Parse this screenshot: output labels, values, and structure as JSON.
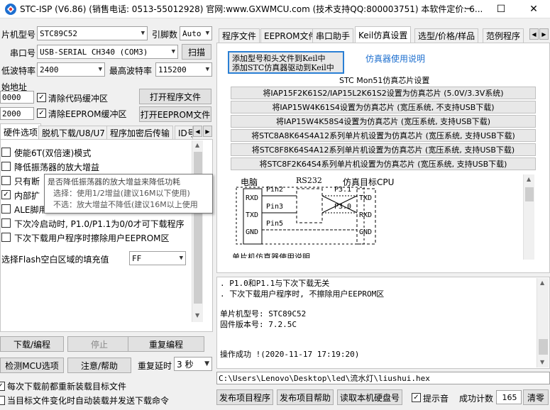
{
  "window": {
    "title": "STC-ISP (V6.86) (销售电话: 0513-55012928) 官网:www.GXWMCU.com  (技术支持QQ:800003751) 本软件定价: 6...",
    "minimize": "─",
    "maximize": "☐",
    "close": "✕"
  },
  "left": {
    "mcu_type_label": "片机型号",
    "mcu_type_value": "STC89C52",
    "pin_label": "引脚数",
    "pin_value": "Auto",
    "port_label": "串口号",
    "port_value": "USB-SERIAL CH340 (COM3)",
    "scan_button": "扫描",
    "min_baud_label": "低波特率",
    "min_baud_value": "2400",
    "max_baud_label": "最高波特率",
    "max_baud_value": "115200",
    "start_addr_label": "始地址",
    "code_addr_value": "0000",
    "clear_code_label": "清除代码缓冲区",
    "open_prog_button": "打开程序文件",
    "eeprom_addr_value": "2000",
    "clear_eeprom_label": "清除EEPROM缓冲区",
    "open_eeprom_button": "打开EEPROM文件",
    "tabs": [
      "硬件选项",
      "脱机下载/U8/U7",
      "程序加密后传输",
      "ID号"
    ],
    "options": [
      {
        "label": "使能6T(双倍速)模式",
        "checked": false
      },
      {
        "label": "降低振荡器的放大增益",
        "checked": false
      },
      {
        "label": "只有断",
        "checked": false
      },
      {
        "label": "内部扩",
        "checked": true
      },
      {
        "label": "ALE脚用",
        "checked": false
      },
      {
        "label": "下次冷启动时, P1.0/P1.1为0/0才可下载程序",
        "checked": false
      },
      {
        "label": "下次下载用户程序时擦除用户EEPROM区",
        "checked": false
      }
    ],
    "fill_label": "选择Flash空白区域的填充值",
    "fill_value": "FF",
    "download_button": "下载/编程",
    "stop_button": "停止",
    "reprogram_button": "重复编程",
    "detect_button": "检测MCU选项",
    "help_button": "注意/帮助",
    "repeat_delay_label": "重复延时",
    "repeat_delay_value": "3 秒",
    "reload_label": "每次下载前都重新装载目标文件",
    "auto_load_label": "当目标文件变化时自动装载并发送下载命令"
  },
  "tooltip": {
    "line1": "是否降低振荡器的放大增益来降低功耗",
    "line2": "选择：使用1/2增益(建议16M以下使用)",
    "line3": "不选：放大增益不降低(建议16M以上使用"
  },
  "right": {
    "tabs": [
      "程序文件",
      "EEPROM文件",
      "串口助手",
      "Keil仿真设置",
      "选型/价格/样品",
      "范例程序"
    ],
    "add_keil_line1": "添加型号和头文件到Keil中",
    "add_keil_line2": "添加STC仿真器驱动到Keil中",
    "emu_help_link": "仿真器使用说明",
    "mon51_title": "STC Mon51仿真芯片设置",
    "emu_buttons": [
      "将IAP15F2K61S2/IAP15L2K61S2设置为仿真芯片 (5.0V/3.3V系统)",
      "将IAP15W4K61S4设置为仿真芯片 (宽压系统, 不支持USB下载)",
      "将IAP15W4K58S4设置为仿真芯片 (宽压系统, 支持USB下载)",
      "将STC8A8K64S4A12系列单片机设置为仿真芯片 (宽压系统, 支持USB下载)",
      "将STC8F8K64S4A12系列单片机设置为仿真芯片 (宽压系统, 支持USB下载)",
      "将STC8F2K64S4系列单片机设置为仿真芯片 (宽压系统, 支持USB下载)"
    ],
    "diagram": {
      "pc_label": "电脑",
      "rs232_label": "RS232",
      "target_label": "仿真目标CPU",
      "rxd": "RXD",
      "txd": "TXD",
      "gnd": "GND",
      "pin2": "Pin2",
      "pin3": "Pin3",
      "pin5": "Pin5",
      "p31": "P3.1",
      "p30": "P3.0",
      "cut_text": "单片机仿真器使用说明"
    },
    "log_lines": [
      ". P1.0和P1.1与下次下载无关",
      ". 下次下载用户程序时, 不擦除用户EEPROM区",
      "",
      "单片机型号: STC89C52",
      "固件版本号: 7.2.5C",
      "",
      "",
      "操作成功 !(2020-11-17 17:19:20)"
    ],
    "file_path": "C:\\Users\\Lenovo\\Desktop\\led\\流水灯\\liushui.hex",
    "publish_button": "发布项目程序",
    "publish_help_button": "发布项目帮助",
    "read_disk_button": "读取本机硬盘号",
    "prompt_sound_label": "提示音",
    "success_count_label": "成功计数",
    "success_count_value": "165",
    "clear_button": "清零"
  }
}
